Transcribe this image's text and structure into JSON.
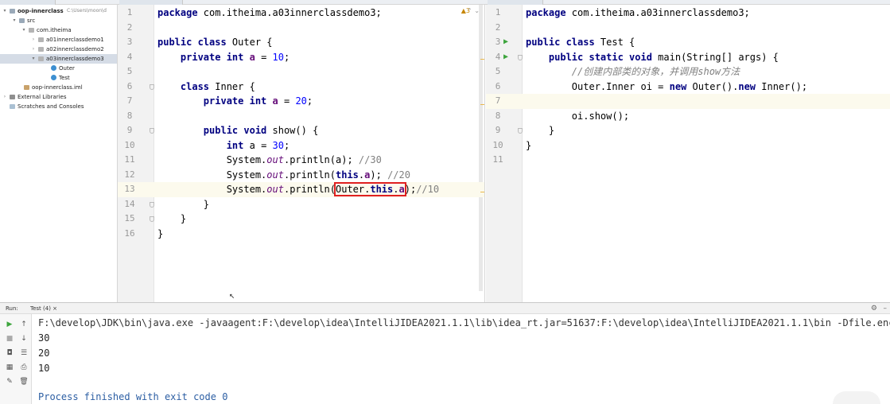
{
  "project": {
    "root_name": "oop-innerclass",
    "root_path": "C:\\Users\\moon\\d",
    "items": [
      {
        "label": "src"
      },
      {
        "label": "com.itheima"
      },
      {
        "label": "a01innerclassdemo1"
      },
      {
        "label": "a02innerclassdemo2"
      },
      {
        "label": "a03innerclassdemo3"
      },
      {
        "label": "Outer"
      },
      {
        "label": "Test"
      },
      {
        "label": "oop-innerclass.iml"
      },
      {
        "label": "External Libraries"
      },
      {
        "label": "Scratches and Consoles"
      }
    ]
  },
  "left_editor": {
    "warning_count": "3",
    "line_numbers": [
      "1",
      "2",
      "3",
      "4",
      "5",
      "6",
      "7",
      "8",
      "9",
      "10",
      "11",
      "12",
      "13",
      "14",
      "15",
      "16"
    ]
  },
  "right_editor": {
    "line_numbers": [
      "1",
      "2",
      "3",
      "4",
      "5",
      "6",
      "7",
      "8",
      "9",
      "10",
      "11"
    ]
  },
  "run_panel": {
    "title": "Run:",
    "tab": "Test (4)",
    "command": "F:\\develop\\JDK\\bin\\java.exe -javaagent:F:\\develop\\idea\\IntelliJIDEA2021.1.1\\lib\\idea_rt.jar=51637:F:\\develop\\idea\\IntelliJIDEA2021.1.1\\bin -Dfile.enco",
    "outputs": [
      "30",
      "20",
      "10"
    ],
    "exit_message": "Process finished with exit code 0"
  },
  "colors": {
    "keyword": "#000080",
    "field": "#660e7a",
    "number": "#0000ff",
    "comment": "#808080",
    "highlight_box": "#e02020",
    "run_icon": "#3da53d"
  }
}
